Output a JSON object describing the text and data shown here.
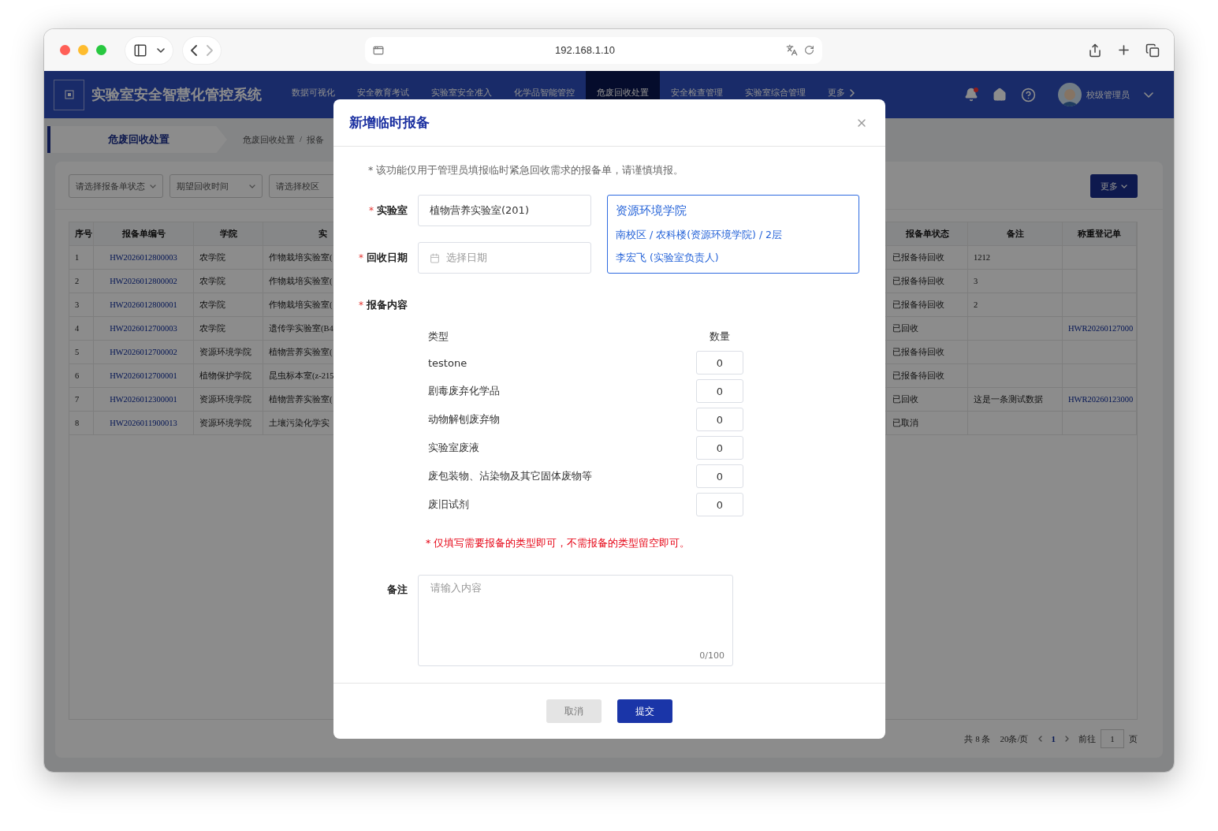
{
  "browser": {
    "url": "192.168.1.10"
  },
  "app": {
    "title": "实验室安全智慧化管控系统",
    "user": "校级管理员",
    "nav": [
      {
        "label": "数据可视化",
        "selected": false
      },
      {
        "label": "安全教育考试",
        "selected": false
      },
      {
        "label": "实验室安全准入",
        "selected": false
      },
      {
        "label": "化学品智能管控",
        "selected": false
      },
      {
        "label": "危废回收处置",
        "selected": true
      },
      {
        "label": "安全检查管理",
        "selected": false
      },
      {
        "label": "实验室综合管理",
        "selected": false
      },
      {
        "label": "更多",
        "selected": false
      }
    ]
  },
  "page": {
    "tab": "危废回收处置",
    "breadcrumb": {
      "separator": "/",
      "items": [
        "危废回收处置",
        "报备"
      ]
    },
    "filters": [
      "请选择报备单状态",
      "期望回收时间",
      "请选择校区"
    ],
    "more_button": "更多",
    "table": {
      "columns_left": [
        "序号",
        "报备单编号",
        "学院",
        "实"
      ],
      "columns_right": [
        "报备单状态",
        "备注",
        "称重登记单"
      ],
      "rows": [
        {
          "index": "1",
          "code": "HW2026012800003",
          "college": "农学院",
          "lab": "作物栽培实验室(",
          "status": "已报备待回收",
          "note": "1212"
        },
        {
          "index": "2",
          "code": "HW2026012800002",
          "college": "农学院",
          "lab": "作物栽培实验室(",
          "status": "已报备待回收",
          "note": "3"
        },
        {
          "index": "3",
          "code": "HW2026012800001",
          "college": "农学院",
          "lab": "作物栽培实验室(",
          "status": "已报备待回收",
          "note": "2"
        },
        {
          "index": "4",
          "code": "HW2026012700003",
          "college": "农学院",
          "lab": "遗传学实验室(B4",
          "status": "已回收",
          "weigh_no": "HWR20260127000"
        },
        {
          "index": "5",
          "code": "HW2026012700002",
          "college": "资源环境学院",
          "lab": "植物营养实验室(",
          "status": "已报备待回收"
        },
        {
          "index": "6",
          "code": "HW2026012700001",
          "college": "植物保护学院",
          "lab": "昆虫标本室(z-215",
          "status": "已报备待回收"
        },
        {
          "index": "7",
          "code": "HW2026012300001",
          "college": "资源环境学院",
          "lab": "植物营养实验室(",
          "status": "已回收",
          "note": "这是一条测试数据",
          "weigh_no": "HWR20260123000"
        },
        {
          "index": "8",
          "code": "HW2026011900013",
          "college": "资源环境学院",
          "lab": "土壤污染化学实",
          "status": "已取消"
        }
      ]
    },
    "pagination": {
      "total": "共 8 条",
      "page_size": "20条/页",
      "current": "1",
      "goto_label": "前往",
      "goto_value": "1",
      "page_suffix": "页"
    }
  },
  "dialog": {
    "title": "新增临时报备",
    "notice": "* 该功能仅用于管理员填报临时紧急回收需求的报备单，请谨慎填报。",
    "lab": {
      "mark": "*",
      "label": "实验室",
      "value": "植物营养实验室(201)"
    },
    "date": {
      "mark": "*",
      "label": "回收日期",
      "placeholder": "选择日期"
    },
    "lab_info": {
      "college": "资源环境学院",
      "location": "南校区 / 农科楼(资源环境学院) / 2层",
      "manager": "李宏飞 (实验室负责人)"
    },
    "content": {
      "mark": "*",
      "label": "报备内容",
      "columns": [
        "类型",
        "数量"
      ],
      "items": [
        {
          "type": "testone",
          "quantity": "0"
        },
        {
          "type": "剧毒废弃化学品",
          "quantity": "0"
        },
        {
          "type": "动物解刨废弃物",
          "quantity": "0"
        },
        {
          "type": "实验室废液",
          "quantity": "0"
        },
        {
          "type": "废包装物、沾染物及其它固体废物等",
          "quantity": "0"
        },
        {
          "type": "废旧试剂",
          "quantity": "0"
        }
      ],
      "hint": "* 仅填写需要报备的类型即可，不需报备的类型留空即可。"
    },
    "remark": {
      "label": "备注",
      "placeholder": "请输入内容",
      "counter": "0/100"
    },
    "buttons": [
      {
        "label": "取消",
        "kind": "secondary"
      },
      {
        "label": "提交",
        "kind": "primary"
      }
    ]
  }
}
